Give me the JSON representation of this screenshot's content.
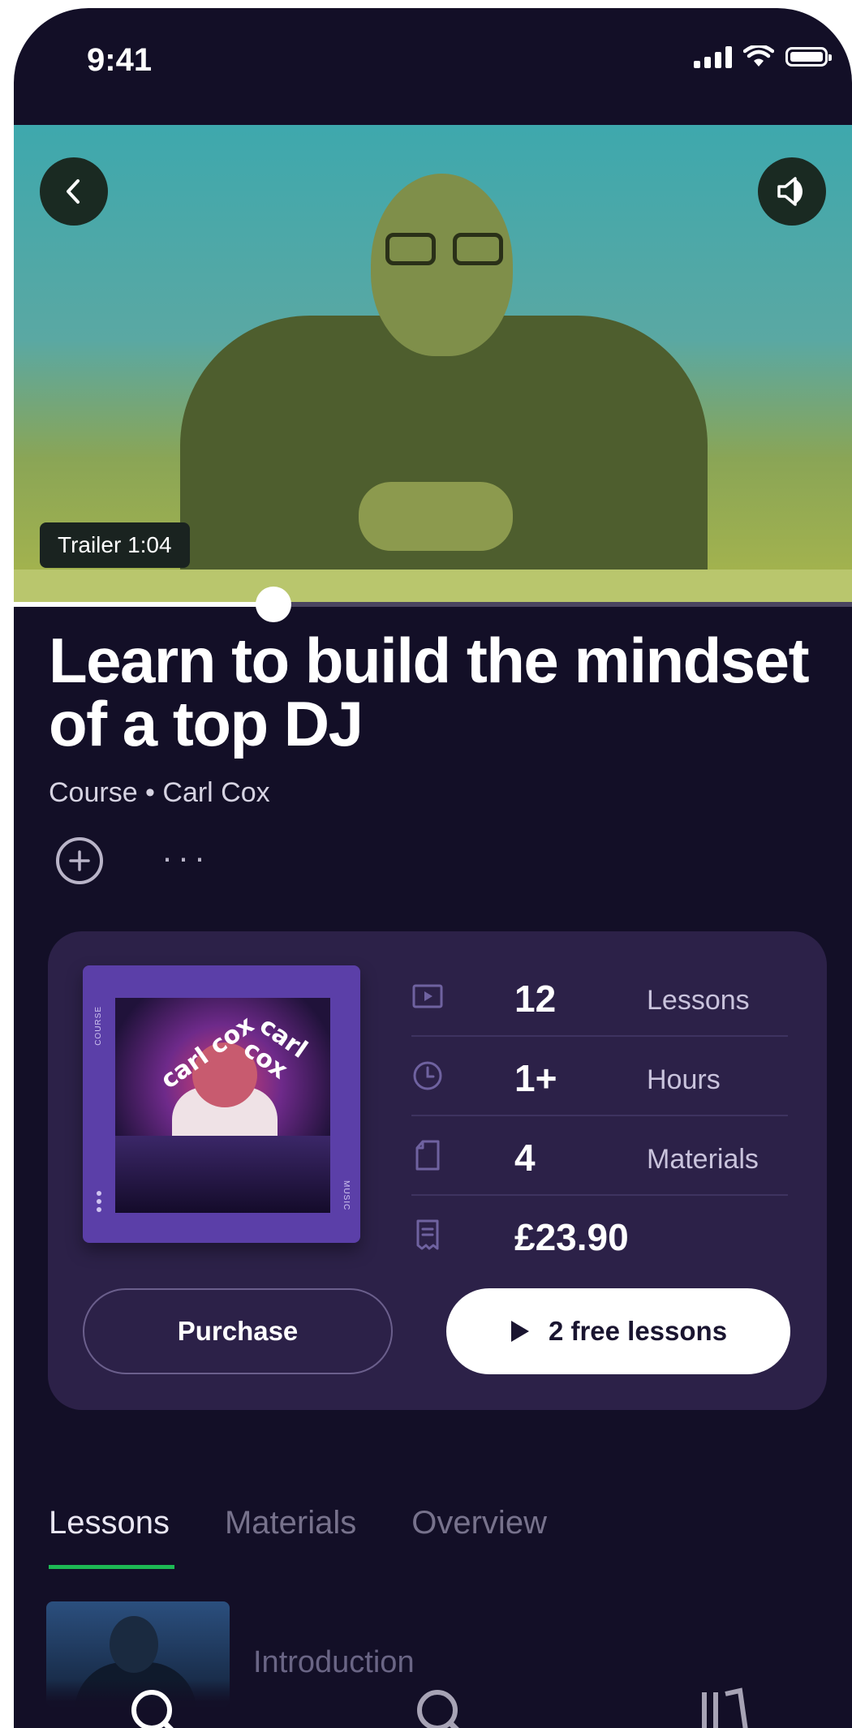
{
  "status_bar": {
    "time": "9:41"
  },
  "video": {
    "trailer_label": "Trailer 1:04",
    "progress": 0.31
  },
  "course": {
    "title": "Learn to build the mindset of a top DJ",
    "subtitle": "Course • Carl Cox",
    "more": "···"
  },
  "cover": {
    "side_left": "COURSE",
    "side_right": "MUSIC",
    "brand_a": "carl cox",
    "brand_b": "carl cox"
  },
  "stats": [
    {
      "icon": "play-square-icon",
      "value": "12",
      "label": "Lessons"
    },
    {
      "icon": "clock-icon",
      "value": "1+",
      "label": "Hours"
    },
    {
      "icon": "document-icon",
      "value": "4",
      "label": "Materials"
    },
    {
      "icon": "receipt-icon",
      "value": "£23.90",
      "label": ""
    }
  ],
  "actions": {
    "purchase_label": "Purchase",
    "free_label": "2 free lessons"
  },
  "tabs": [
    {
      "label": "Lessons",
      "active": true
    },
    {
      "label": "Materials",
      "active": false
    },
    {
      "label": "Overview",
      "active": false
    }
  ],
  "lessons": [
    {
      "title": "Introduction"
    }
  ],
  "colors": {
    "background": "#130f27",
    "card": "#2c2148",
    "accent": "#1db954"
  }
}
